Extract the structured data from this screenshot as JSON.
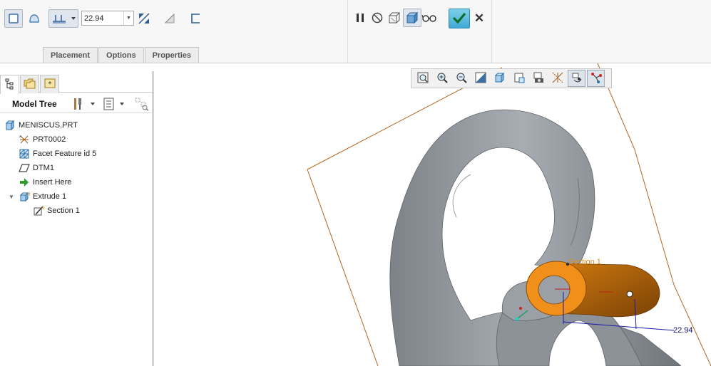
{
  "dashboard": {
    "depth_value": "22.94",
    "tabs": [
      {
        "label": "Placement"
      },
      {
        "label": "Options"
      },
      {
        "label": "Properties"
      }
    ],
    "left_icons": [
      "solid-extrude-icon",
      "surface-extrude-icon",
      "blind-depth-icon",
      "flip-direction-icon",
      "remove-material-icon",
      "thicken-icon"
    ],
    "mid_icons": [
      "pause-icon",
      "no-preview-icon",
      "geometry-preview-icon",
      "feature-preview-icon",
      "verify-glasses-icon"
    ]
  },
  "model_tree": {
    "title": "Model Tree",
    "items": [
      {
        "label": "MENISCUS.PRT",
        "icon": "part-icon"
      },
      {
        "label": "PRT0002",
        "icon": "csys-icon"
      },
      {
        "label": "Facet Feature id 5",
        "icon": "facet-feature-icon"
      },
      {
        "label": "DTM1",
        "icon": "datum-plane-icon"
      },
      {
        "label": "Insert Here",
        "icon": "insert-arrow-icon"
      },
      {
        "label": "Extrude 1",
        "icon": "extrude-icon"
      },
      {
        "label": "Section 1",
        "icon": "sketch-icon"
      }
    ]
  },
  "graphics": {
    "section_label": "Section 1",
    "dimension_value": "22.94"
  },
  "colors": {
    "accent": "#3fa9d4",
    "model_gray": "#8f959b",
    "extrude_orange": "#e88a12",
    "datum_plane": "#b5651d",
    "dimension": "#1a1aa8"
  }
}
